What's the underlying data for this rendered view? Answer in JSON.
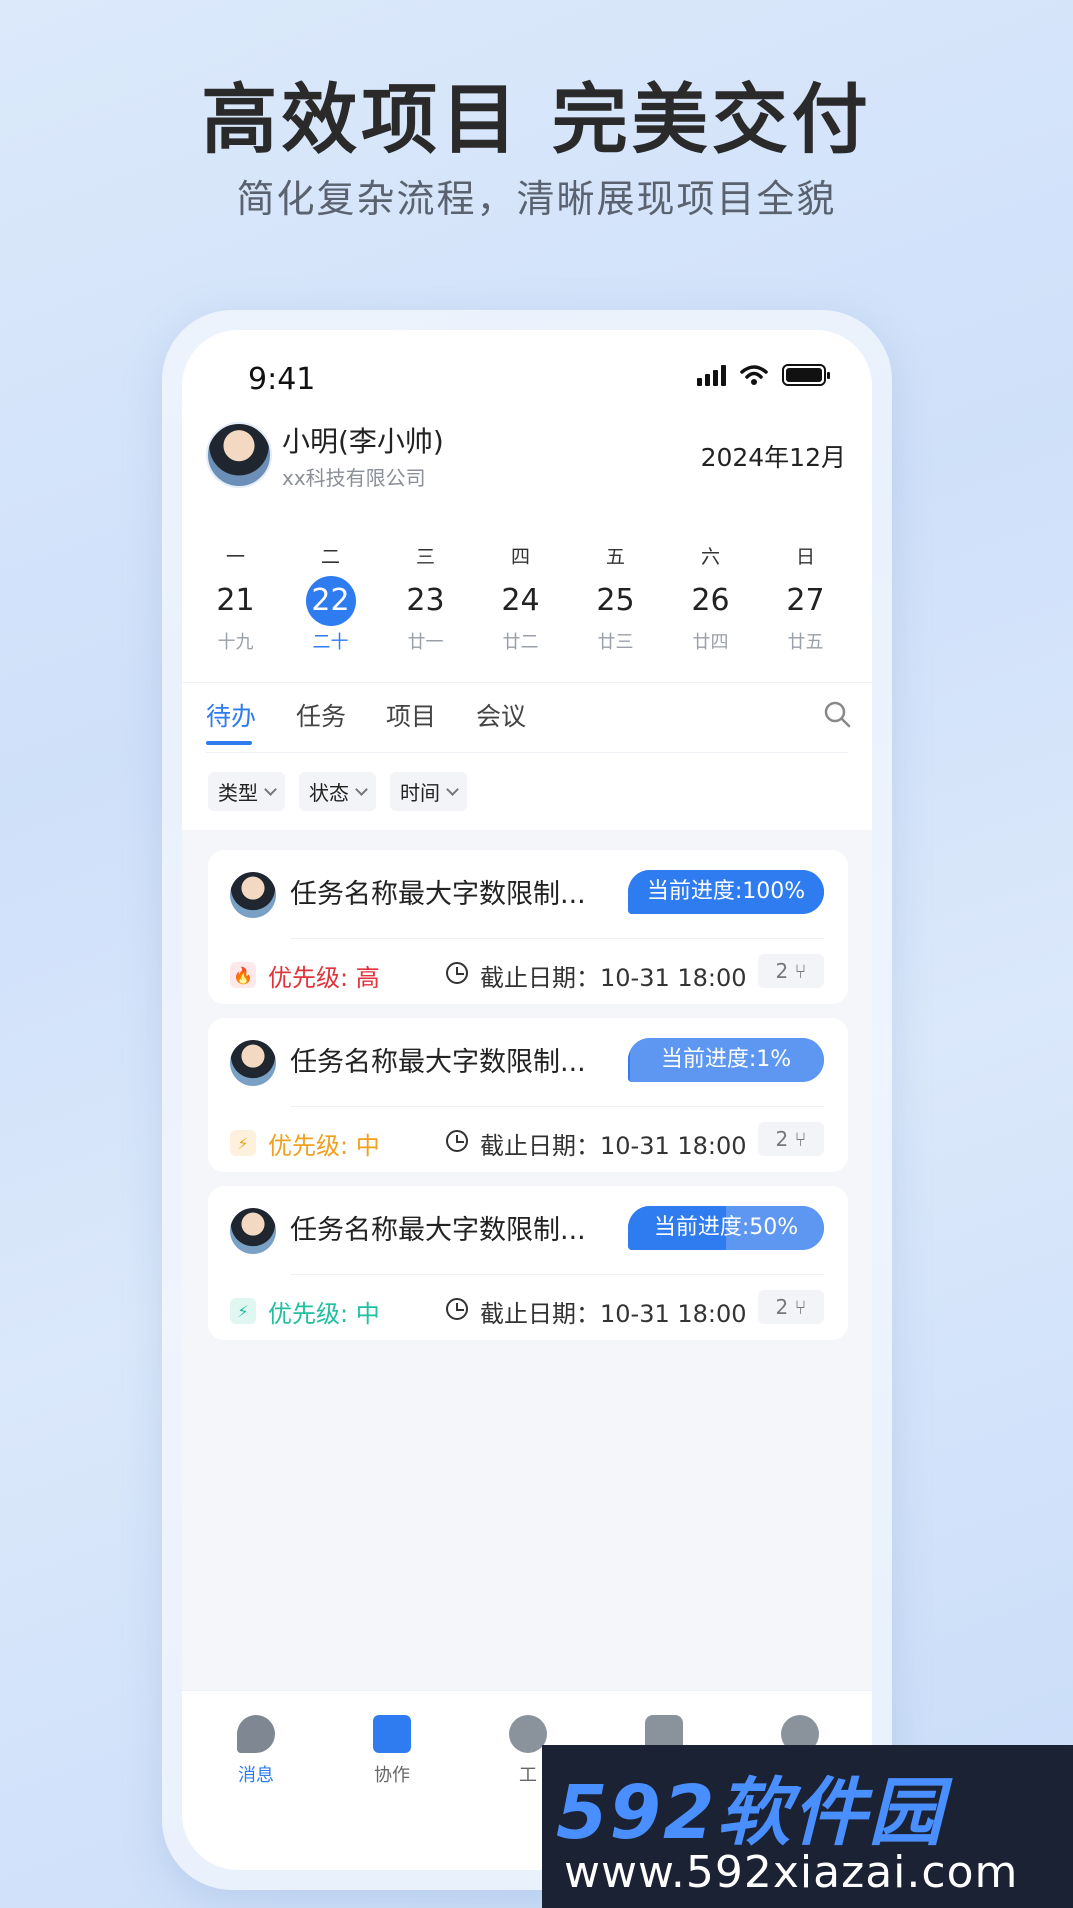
{
  "hero": {
    "title": "高效项目 完美交付",
    "subtitle": "简化复杂流程，清晰展现项目全貌"
  },
  "status_bar": {
    "time": "9:41"
  },
  "user": {
    "name": "小明(李小帅)",
    "company": "xx科技有限公司"
  },
  "calendar": {
    "month": "2024年12月",
    "days": [
      {
        "weekday": "一",
        "date": "21",
        "lunar": "十九"
      },
      {
        "weekday": "二",
        "date": "22",
        "lunar": "二十",
        "selected": true
      },
      {
        "weekday": "三",
        "date": "23",
        "lunar": "廿一"
      },
      {
        "weekday": "四",
        "date": "24",
        "lunar": "廿二"
      },
      {
        "weekday": "五",
        "date": "25",
        "lunar": "廿三"
      },
      {
        "weekday": "六",
        "date": "26",
        "lunar": "廿四"
      },
      {
        "weekday": "日",
        "date": "27",
        "lunar": "廿五"
      }
    ]
  },
  "tabs": [
    "待办",
    "任务",
    "项目",
    "会议"
  ],
  "filters": [
    "类型",
    "状态",
    "时间"
  ],
  "tasks": [
    {
      "title": "任务名称最大字数限制...",
      "progress": "当前进度:100%",
      "progress_value": 100,
      "priority": "优先级: 高",
      "priority_color": "#e0333b",
      "priority_icon": "fire-icon",
      "deadline": "截止日期：10-31 18:00",
      "subtasks": "2"
    },
    {
      "title": "任务名称最大字数限制...",
      "progress": "当前进度:1%",
      "progress_value": 1,
      "priority": "优先级: 中",
      "priority_color": "#f0a020",
      "priority_icon": "lightning-icon",
      "deadline": "截止日期：10-31 18:00",
      "subtasks": "2"
    },
    {
      "title": "任务名称最大字数限制...",
      "progress": "当前进度:50%",
      "progress_value": 50,
      "priority": "优先级: 中",
      "priority_color": "#1fbf9f",
      "priority_icon": "lightning-icon",
      "deadline": "截止日期：10-31 18:00",
      "subtasks": "2"
    }
  ],
  "bottom_nav": [
    {
      "label": "消息",
      "icon": "message-icon",
      "active": true
    },
    {
      "label": "协作",
      "icon": "collaboration-icon"
    },
    {
      "label": "工",
      "icon": "workbench-icon"
    },
    {
      "label": "",
      "icon": "app-icon"
    },
    {
      "label": "",
      "icon": "profile-icon"
    }
  ],
  "watermark": {
    "brand": "592软件园",
    "url": "www.592xiazai.com"
  },
  "colors": {
    "accent": "#2f7bf0",
    "background": "#dce9fb"
  }
}
